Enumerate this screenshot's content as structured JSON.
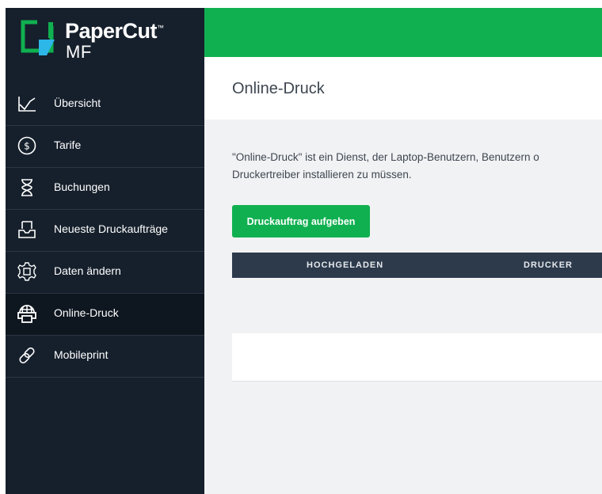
{
  "brand": {
    "name": "PaperCut",
    "trademark": "™",
    "edition": "MF",
    "colors": {
      "green": "#10b050",
      "blue": "#2db6e8",
      "sidebar": "#16202c"
    }
  },
  "sidebar": {
    "items": [
      {
        "label": "Übersicht",
        "icon": "chart-line-icon",
        "active": false
      },
      {
        "label": "Tarife",
        "icon": "dollar-circle-icon",
        "active": false
      },
      {
        "label": "Buchungen",
        "icon": "hourglass-icon",
        "active": false
      },
      {
        "label": "Neueste Druckaufträge",
        "icon": "printer-tray-icon",
        "active": false
      },
      {
        "label": "Daten ändern",
        "icon": "gear-icon",
        "active": false
      },
      {
        "label": "Online-Druck",
        "icon": "web-print-icon",
        "active": true
      },
      {
        "label": "Mobileprint",
        "icon": "link-icon",
        "active": false
      }
    ]
  },
  "header": {
    "title": "Online-Druck"
  },
  "main": {
    "description_line1": "\"Online-Druck\" ist ein Dienst, der Laptop-Benutzern, Benutzern o",
    "description_line2": "Druckertreiber installieren zu müssen.",
    "submit_button": "Druckauftrag aufgeben",
    "table": {
      "columns": [
        "HOCHGELADEN",
        "DRUCKER"
      ],
      "rows": []
    }
  }
}
